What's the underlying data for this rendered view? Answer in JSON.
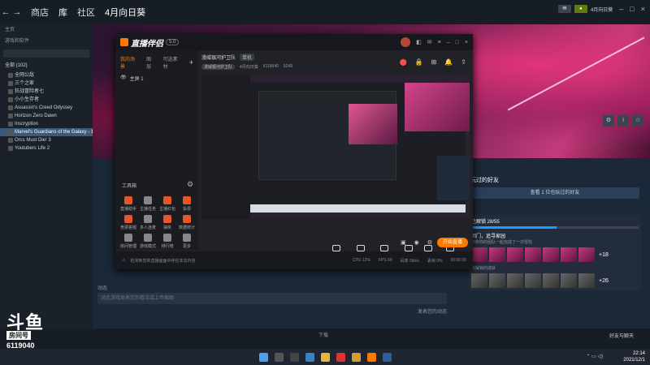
{
  "steam": {
    "nav": {
      "back": "←",
      "forward": "→",
      "store": "商店",
      "library": "库",
      "community": "社区",
      "user": "4月向日葵"
    },
    "top_right": {
      "btn1": "",
      "btn2": "",
      "user_label": "4月向日葵"
    },
    "sidebar": {
      "home": "主页",
      "filter_label": "游戏和软件",
      "category": "全部 (102)",
      "items": [
        "全网公敌",
        "三个之家",
        "狂战冒险者七",
        "小小生存者",
        "Assassin's Creed Odyssey",
        "Horizon Zero Dawn",
        "Inscryption",
        "Marvel's Guardians of the Galaxy - 1",
        "Orcs Must Die! 3",
        "Youtubers Life 2"
      ]
    },
    "right_panel": {
      "friends_title": "玩过的好友",
      "friends_button": "查看 1 位也玩过的好友",
      "achievements_label": "已解锁 28/55",
      "achievements_progress": 0.51,
      "ach_title": "回门，追寻家园",
      "ach_sub": "你和你的团队一起完成了一次冒险",
      "ach_more": "+18",
      "locked_label": "未解锁的成就",
      "locked_more": "+26"
    },
    "comment": {
      "title": "动态",
      "placeholder": "对此游戏发表您的看法或上传截图",
      "link": "发表您的动态"
    },
    "bottom": {
      "downloads": "下载",
      "friends": "好友与聊天"
    }
  },
  "douyu": {
    "brand": "直播伴侣",
    "version": "5.0",
    "tabs": [
      "我的场景",
      "图层",
      "可选素材"
    ],
    "scene": "主屏 1",
    "tools_title": "工具箱",
    "tools": [
      "直播助手",
      "主播任务",
      "主播红包",
      "投票",
      "竞猜答题",
      "多人连麦",
      "抽奖",
      "数据统计",
      "房间管理",
      "游戏模式",
      "排行榜",
      "更多"
    ],
    "room_title": "漫威银河护卫队",
    "room_tag": "单机",
    "room_sub": [
      "漫威银河护卫队",
      "4月向日葵",
      "6119040",
      "5249"
    ],
    "bottom_tools": [
      "直播画面",
      "摄像头",
      "手机投屏",
      "多媒体",
      "音频",
      "场景布置"
    ],
    "start_button": "开始直播",
    "status_left": "检测到您的直播画面中存在非法内容",
    "status_stats": [
      "CPU 12%",
      "FPS 60",
      "码率 0kb/s",
      "丢帧 0%",
      "00:00:00"
    ]
  },
  "watermark": {
    "brand": "斗鱼",
    "sub": "房间号",
    "room_id": "6119040"
  },
  "clock": {
    "time": "22:14",
    "date": "2021/12/1"
  }
}
